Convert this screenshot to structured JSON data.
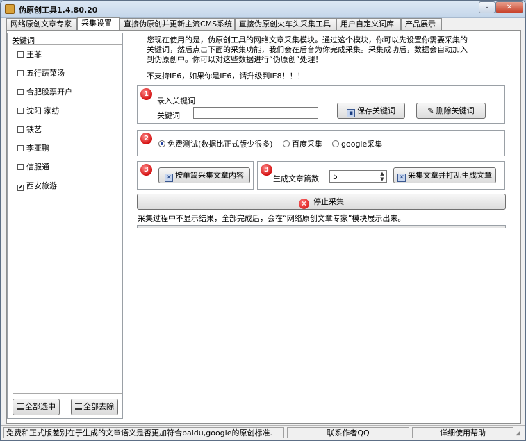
{
  "window": {
    "title": "伪原创工具1.4.80.20"
  },
  "tabs": [
    "网络原创文章专家",
    "采集设置",
    "直接伪原创并更新主流CMS系统",
    "直接伪原创火车头采集工具",
    "用户自定义词库",
    "产品展示"
  ],
  "keywords": {
    "title": "关键词",
    "items": [
      {
        "label": "王菲",
        "checked": false
      },
      {
        "label": "五行蔬菜汤",
        "checked": false
      },
      {
        "label": "合肥股票开户",
        "checked": false
      },
      {
        "label": "沈阳 家纺",
        "checked": false
      },
      {
        "label": "铁艺",
        "checked": false
      },
      {
        "label": "李亚鹏",
        "checked": false
      },
      {
        "label": "信服通",
        "checked": false
      },
      {
        "label": "西安旅游",
        "checked": true
      }
    ],
    "select_all": "全部选中",
    "remove_all": "全部去除"
  },
  "description": "您现在使用的是，伪原创工具的网络文章采集模块。通过这个模块，你可以先设置你需要采集的关键词，然后点击下面的采集功能，我们会在后台为你完成采集。采集成功后，数据会自动加入到伪原创中。你可以对这些数据进行“伪原创”处理！",
  "warning": "不支持IE6，如果你是IE6，请升级到IE8！！！",
  "step1": {
    "badge": "1",
    "heading": "录入关键词",
    "field_label": "关键词",
    "field_value": "",
    "save_btn": "保存关键词",
    "delete_btn": "删除关键词"
  },
  "step2": {
    "badge": "2",
    "options": [
      {
        "label": "免费测试(数据比正式版少很多)",
        "selected": true
      },
      {
        "label": "百度采集",
        "selected": false
      },
      {
        "label": "google采集",
        "selected": false
      }
    ]
  },
  "step3a": {
    "badge": "3",
    "btn": "按单篇采集文章内容"
  },
  "step3b": {
    "badge": "3",
    "count_label": "生成文章篇数",
    "count_value": "5",
    "btn": "采集文章并打乱生成文章"
  },
  "stop": {
    "label": "停止采集"
  },
  "info": "采集过程中不显示结果，全部完成后，会在“网络原创文章专家”模块展示出来。",
  "progress": 0,
  "status": {
    "message": "免费和正式版差别在于生成的文章语义是否更加符合baidu,google的原创标准.",
    "contact": "联系作者QQ",
    "help": "详细使用帮助"
  }
}
